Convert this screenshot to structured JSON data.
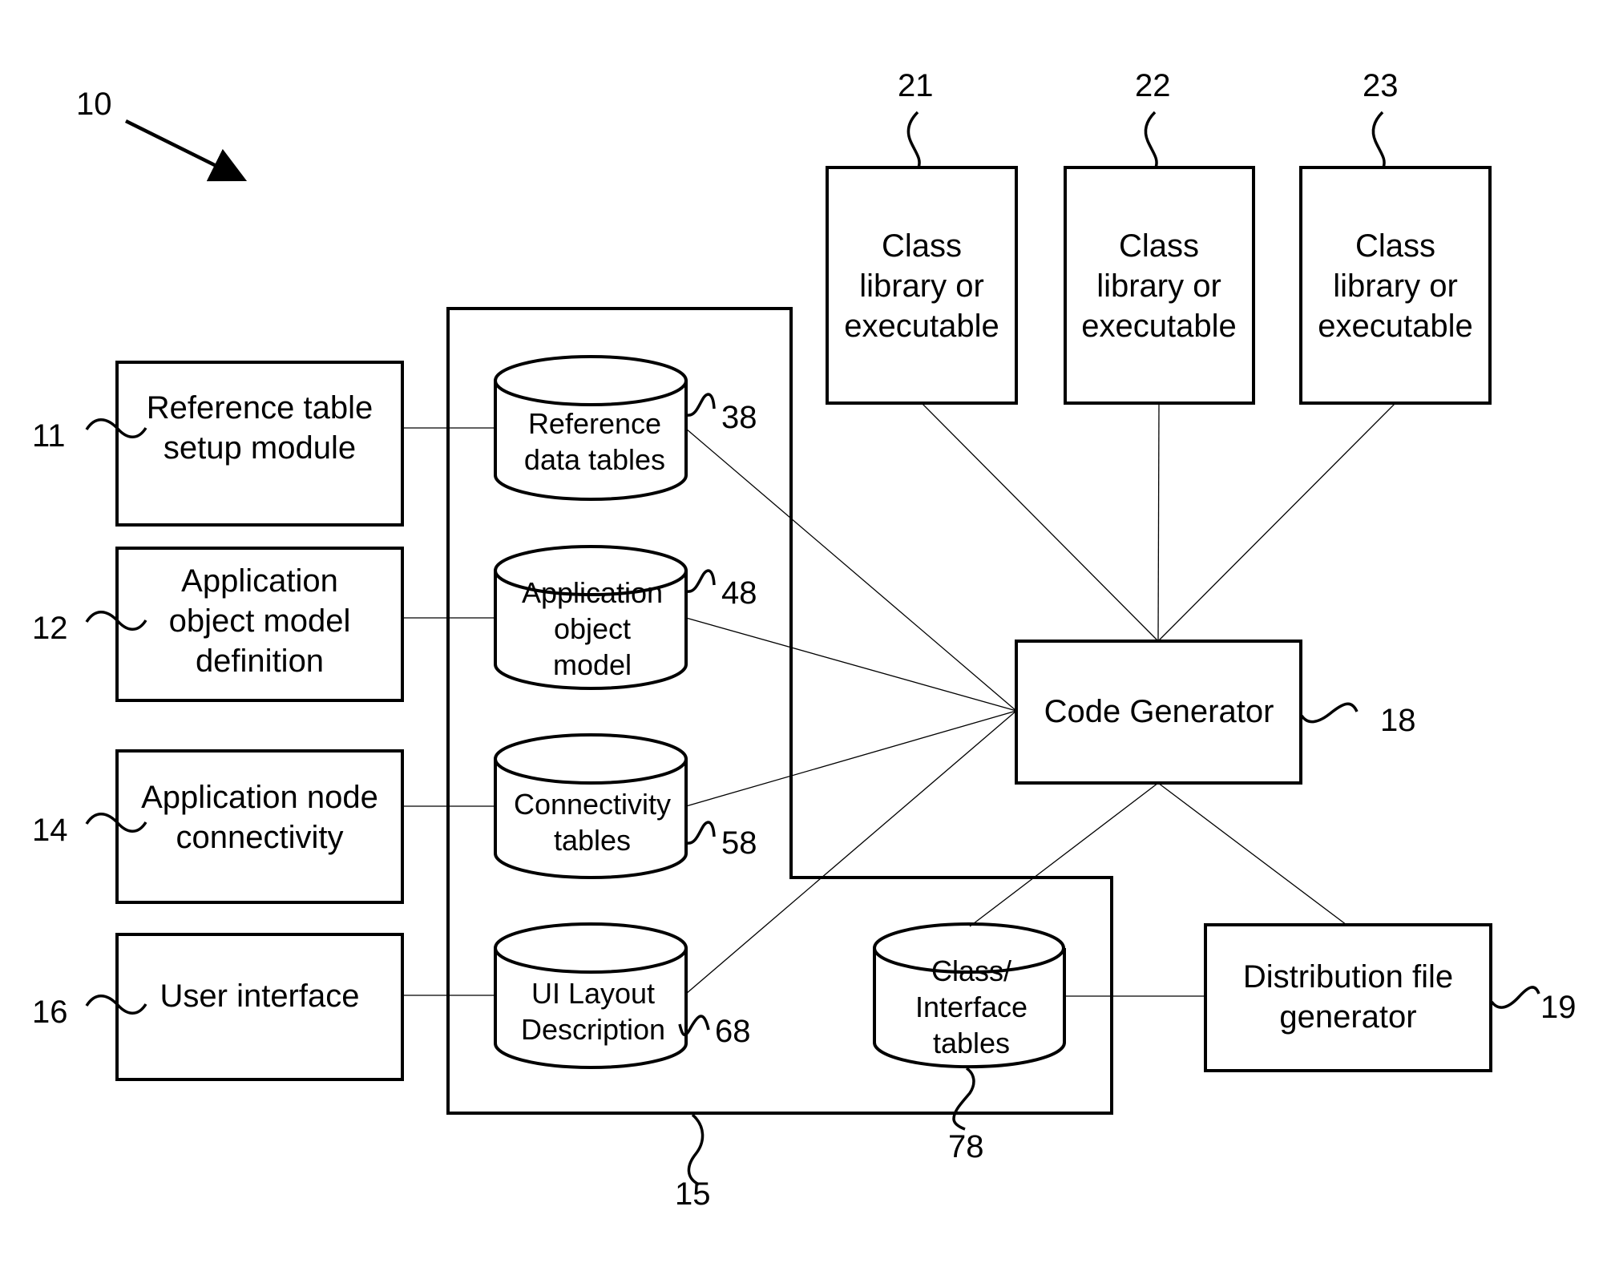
{
  "figure": {
    "reference": "10",
    "container_reference": "15"
  },
  "inputs": [
    {
      "ref": "11",
      "lines": [
        "Reference table",
        "setup module"
      ]
    },
    {
      "ref": "12",
      "lines": [
        "Application",
        "object model",
        "definition"
      ]
    },
    {
      "ref": "14",
      "lines": [
        "Application node",
        "connectivity"
      ]
    },
    {
      "ref": "16",
      "lines": [
        "User interface"
      ]
    }
  ],
  "stores": [
    {
      "ref": "38",
      "lines": [
        "Reference",
        "data tables"
      ]
    },
    {
      "ref": "48",
      "lines": [
        "Application",
        "object",
        "model"
      ]
    },
    {
      "ref": "58",
      "lines": [
        "Connectivity",
        "tables"
      ]
    },
    {
      "ref": "68",
      "lines": [
        "UI Layout",
        "Description"
      ]
    },
    {
      "ref": "78",
      "lines": [
        "Class/",
        "Interface",
        "tables"
      ]
    }
  ],
  "outputs": [
    {
      "ref": "21",
      "lines": [
        "Class",
        "library or",
        "executable"
      ]
    },
    {
      "ref": "22",
      "lines": [
        "Class",
        "library or",
        "executable"
      ]
    },
    {
      "ref": "23",
      "lines": [
        "Class",
        "library or",
        "executable"
      ]
    }
  ],
  "code_generator": {
    "ref": "18",
    "label": "Code Generator"
  },
  "distribution": {
    "ref": "19",
    "lines": [
      "Distribution file",
      "generator"
    ]
  }
}
